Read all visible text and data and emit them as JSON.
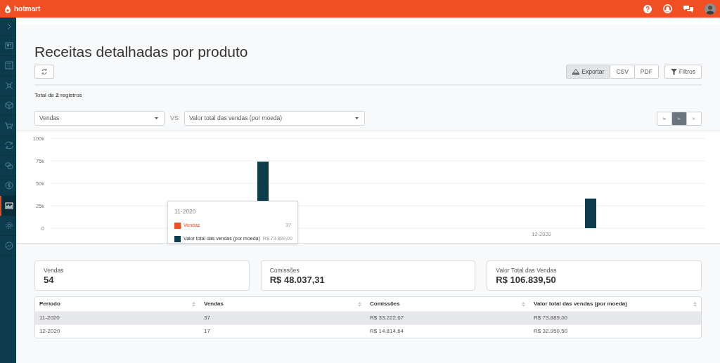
{
  "topbar": {
    "brand": "hotmart"
  },
  "sidebar": {
    "items": [
      {
        "selected": false
      },
      {
        "selected": false
      },
      {
        "selected": false
      },
      {
        "selected": false
      },
      {
        "selected": false
      },
      {
        "selected": false
      },
      {
        "selected": false
      },
      {
        "selected": false
      },
      {
        "selected": true
      },
      {
        "selected": false
      },
      {
        "selected": false
      }
    ]
  },
  "page": {
    "title": "Receitas detalhadas por produto",
    "total": "Total de **2** registros"
  },
  "export": {
    "buttons": [
      {
        "label": "Exportar",
        "selected": true
      },
      {
        "label": "CSV",
        "selected": false
      },
      {
        "label": "PDF",
        "selected": false
      }
    ],
    "filter": "Filtros"
  },
  "compare": {
    "left": "Vendas",
    "vs": "VS",
    "right": "Valor total das vendas (por moeda)"
  },
  "chart_types": [
    {
      "selected": false
    },
    {
      "selected": true
    },
    {
      "selected": false
    }
  ],
  "chart": {
    "chart_data": {
      "type": "bar",
      "categories": [
        null,
        "12-2020"
      ],
      "series": [
        {
          "name": "Valor total das vendas (por moeda)",
          "color": "#0c3c4c",
          "values": [
            74000,
            33000
          ]
        }
      ],
      "ylim": [
        0,
        100000
      ],
      "grid": true,
      "yticks": [
        {
          "value": 0,
          "label": "0"
        },
        {
          "value": 25000,
          "label": "25k"
        },
        {
          "value": 50000,
          "label": "50k"
        },
        {
          "value": 75000,
          "label": "75k"
        },
        {
          "value": 100000,
          "label": "100k"
        }
      ]
    },
    "tooltip": {
      "title": "11-2020",
      "rows": [
        {
          "kind": "extra",
          "label": "Vendas",
          "value": "37",
          "color": "#f04e23"
        },
        {
          "kind": "series",
          "value": "R$ 73.889,00"
        }
      ]
    }
  },
  "stats": [
    {
      "label": "Vendas",
      "value": "54"
    },
    {
      "label": "Comissões",
      "value": "R$ 48.037,31"
    },
    {
      "label": "Valor Total das Vendas",
      "value": "R$ 106.839,50"
    }
  ],
  "table": {
    "columns": [
      "Período",
      "Vendas",
      "Comissões",
      "Valor total das vendas (por moeda)"
    ],
    "rows": [
      {
        "cells": [
          "11-2020",
          "37",
          "R$ 33.222,67",
          "R$ 73.889,00"
        ],
        "selected": true
      },
      {
        "cells": [
          "12-2020",
          "17",
          "R$ 14.814,64",
          "R$ 32.950,50"
        ],
        "selected": false
      }
    ]
  }
}
